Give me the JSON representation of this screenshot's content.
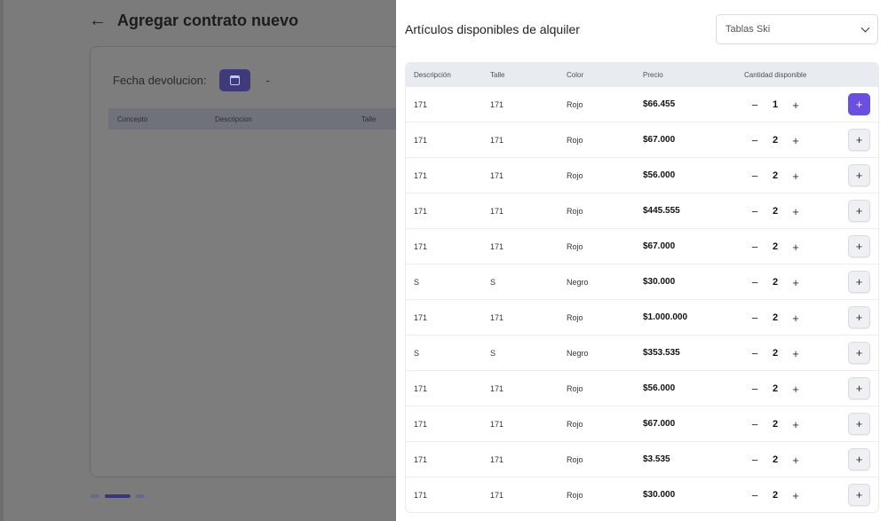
{
  "background": {
    "title": "Agregar contrato nuevo",
    "fecha_label": "Fecha devolucion:",
    "fecha_value": "-",
    "table_headers": [
      "Concepto",
      "Descripcion",
      "Talle"
    ]
  },
  "drawer": {
    "title": "Artículos disponibles de alquiler",
    "category_select": "Tablas Ski",
    "headers": {
      "descripcion": "Descripción",
      "talle": "Talle",
      "color": "Color",
      "precio": "Precio",
      "cantidad": "Cantidad disponible"
    },
    "rows": [
      {
        "descripcion": "171",
        "talle": "171",
        "color": "Rojo",
        "precio": "$66.455",
        "cantidad": "1"
      },
      {
        "descripcion": "171",
        "talle": "171",
        "color": "Rojo",
        "precio": "$67.000",
        "cantidad": "2"
      },
      {
        "descripcion": "171",
        "talle": "171",
        "color": "Rojo",
        "precio": "$56.000",
        "cantidad": "2"
      },
      {
        "descripcion": "171",
        "talle": "171",
        "color": "Rojo",
        "precio": "$445.555",
        "cantidad": "2"
      },
      {
        "descripcion": "171",
        "talle": "171",
        "color": "Rojo",
        "precio": "$67.000",
        "cantidad": "2"
      },
      {
        "descripcion": "S",
        "talle": "S",
        "color": "Negro",
        "precio": "$30.000",
        "cantidad": "2"
      },
      {
        "descripcion": "171",
        "talle": "171",
        "color": "Rojo",
        "precio": "$1.000.000",
        "cantidad": "2"
      },
      {
        "descripcion": "S",
        "talle": "S",
        "color": "Negro",
        "precio": "$353.535",
        "cantidad": "2"
      },
      {
        "descripcion": "171",
        "talle": "171",
        "color": "Rojo",
        "precio": "$56.000",
        "cantidad": "2"
      },
      {
        "descripcion": "171",
        "talle": "171",
        "color": "Rojo",
        "precio": "$67.000",
        "cantidad": "2"
      },
      {
        "descripcion": "171",
        "talle": "171",
        "color": "Rojo",
        "precio": "$3.535",
        "cantidad": "2"
      },
      {
        "descripcion": "171",
        "talle": "171",
        "color": "Rojo",
        "precio": "$30.000",
        "cantidad": "2"
      }
    ],
    "minus_symbol": "−",
    "plus_symbol": "+",
    "add_symbol": "+"
  },
  "colors": {
    "accent": "#6b4fe0"
  },
  "icons": {
    "back": "arrow-left-icon",
    "calendar": "calendar-icon",
    "select": "chevron-down-icon"
  }
}
